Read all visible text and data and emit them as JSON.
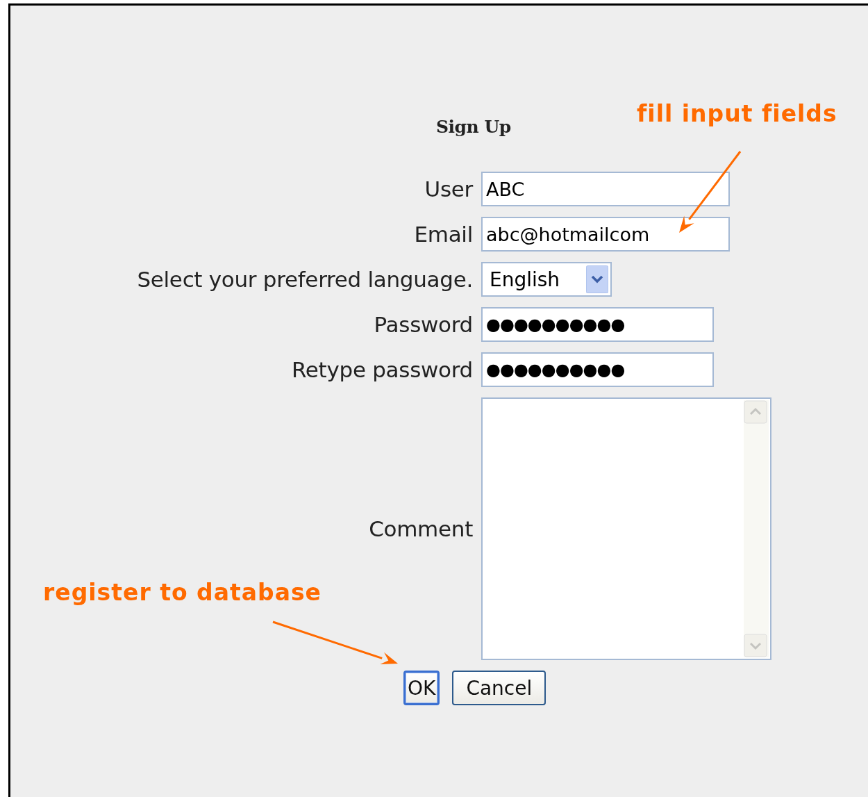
{
  "title": "Sign Up",
  "fields": [
    {
      "kind": "text",
      "label": "User",
      "value": "ABC"
    },
    {
      "kind": "text",
      "label": "Email",
      "value": "abc@hotmailcom"
    },
    {
      "kind": "select",
      "label": "Select your preferred language.",
      "value": "English"
    },
    {
      "kind": "password",
      "label": "Password",
      "value": "●●●●●●●●●●"
    },
    {
      "kind": "password",
      "label": "Retype password",
      "value": "●●●●●●●●●●"
    },
    {
      "kind": "textarea",
      "label": "Comment"
    }
  ],
  "buttons": [
    {
      "label": "OK",
      "focused": true
    },
    {
      "label": "Cancel",
      "focused": false
    }
  ],
  "annotations": [
    {
      "text": "fill input fields"
    },
    {
      "text": "register to database"
    }
  ]
}
